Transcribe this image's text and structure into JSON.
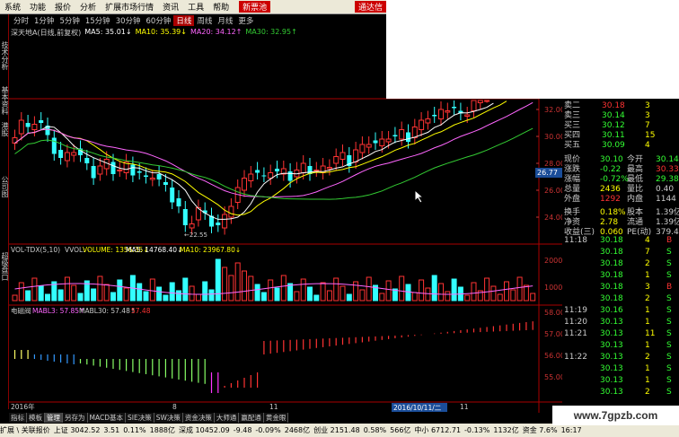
{
  "menu": {
    "items": [
      "系统",
      "功能",
      "报价",
      "分析",
      "扩展市场行情",
      "资讯",
      "工具",
      "帮助"
    ],
    "badge": "新票池",
    "badge2": "通达信"
  },
  "left_tabs": [
    "技术分析",
    "基本资料",
    "港股",
    "公司图",
    "超级盘口"
  ],
  "periods": [
    "分时",
    "1分钟",
    "5分钟",
    "15分钟",
    "30分钟",
    "60分钟",
    "日线",
    "周线",
    "月线",
    "更多"
  ],
  "active_period": "日线",
  "ma_legend": [
    {
      "text": "深天地A(日线,前复权)",
      "color": "#cccccc"
    },
    {
      "text": "MA5: 35.01↓",
      "color": "#ffffff"
    },
    {
      "text": "MA10: 35.39↓",
      "color": "#ffff00"
    },
    {
      "text": "MA20: 34.12↑",
      "color": "#ff66ff"
    },
    {
      "text": "MA30: 32.95↑",
      "color": "#33cc33"
    }
  ],
  "price_axis": [
    "32.00",
    "30.00",
    "28.00",
    "26.00",
    "24.00"
  ],
  "price_tag": "26.77",
  "low_label": "22.55",
  "vol_legend": {
    "title": "VOL-TDX(5,10)",
    "vvol": "VVOL: -",
    "vol": "VOLUME: 1356.35↓",
    "ma5": "MA5: 14768.40↓",
    "ma10": "MA10: 23967.80↓"
  },
  "vol_axis": [
    "20000",
    "10000"
  ],
  "ind_legend": {
    "title": "电磁阀",
    "mabl3": "MABL3: 57.85↑",
    "mabl30": "MABL30: 57.48↑",
    "val": "57.48"
  },
  "ind_axis": [
    "58.00",
    "57.00",
    "56.00",
    "55.00"
  ],
  "date_axis": {
    "start": "2016年",
    "mid": "8",
    "mid2": "11",
    "date_box": "2016/10/11/二",
    "end": "11"
  },
  "bottom_tabs": [
    "指标",
    "模板",
    "管理",
    "另存为",
    "MACD基本",
    "SIE决策",
    "SW决策",
    "资金决策",
    "大师通",
    "赢配通",
    "黄金眼"
  ],
  "status": [
    "上证 3042.52",
    "3.51",
    "0.11%",
    "1888亿",
    "深成 10452.09",
    "-9.48",
    "-0.09%",
    "2468亿",
    "创业 2151.48",
    "0.58%",
    "566亿",
    "中小 6712.71",
    "-0.13%",
    "1132亿",
    "资金 7.6%",
    "16:17"
  ],
  "status2": "扩展 \\ 关联报价",
  "order_book": [
    {
      "label": "卖二",
      "price": "30.18",
      "vol": "3"
    },
    {
      "label": "卖三",
      "price": "30.14",
      "vol": "3"
    },
    {
      "label": "买三",
      "price": "30.12",
      "vol": "7"
    },
    {
      "label": "买四",
      "price": "30.11",
      "vol": "15"
    },
    {
      "label": "买五",
      "price": "30.09",
      "vol": "4"
    }
  ],
  "quote": [
    {
      "l1": "现价",
      "v1": "30.10",
      "l2": "今开",
      "v2": "30.14"
    },
    {
      "l1": "涨跌",
      "v1": "-0.22",
      "l2": "最高",
      "v2": "30.33"
    },
    {
      "l1": "涨幅",
      "v1": "-0.72%",
      "l2": "最低",
      "v2": "29.38"
    },
    {
      "l1": "总量",
      "v1": "2436",
      "l2": "量比",
      "v2": "0.40"
    },
    {
      "l1": "外盘",
      "v1": "1292",
      "l2": "内盘",
      "v2": "1144"
    },
    {
      "l1": "换手",
      "v1": "0.18%",
      "l2": "股本",
      "v2": "1.39亿"
    },
    {
      "l1": "净资",
      "v1": "2.78",
      "l2": "流通",
      "v2": "1.39亿"
    },
    {
      "l1": "收益(三)",
      "v1": "0.060",
      "l2": "PE(动)",
      "v2": "379.4"
    }
  ],
  "ticks": [
    {
      "t": "11:18",
      "p": "30.18",
      "v": "4",
      "s": "B"
    },
    {
      "t": "",
      "p": "30.18",
      "v": "7",
      "s": "S"
    },
    {
      "t": "",
      "p": "30.18",
      "v": "2",
      "s": "S"
    },
    {
      "t": "",
      "p": "30.18",
      "v": "1",
      "s": "S"
    },
    {
      "t": "",
      "p": "30.18",
      "v": "3",
      "s": "B"
    },
    {
      "t": "",
      "p": "30.18",
      "v": "2",
      "s": "S"
    },
    {
      "t": "11:19",
      "p": "30.16",
      "v": "1",
      "s": "S"
    },
    {
      "t": "11:20",
      "p": "30.13",
      "v": "1",
      "s": "S"
    },
    {
      "t": "11:21",
      "p": "30.13",
      "v": "11",
      "s": "S"
    },
    {
      "t": "",
      "p": "30.13",
      "v": "1",
      "s": "S"
    },
    {
      "t": "11:22",
      "p": "30.13",
      "v": "2",
      "s": "S"
    },
    {
      "t": "",
      "p": "30.13",
      "v": "1",
      "s": "S"
    },
    {
      "t": "",
      "p": "30.13",
      "v": "1",
      "s": "S"
    },
    {
      "t": "",
      "p": "30.13",
      "v": "2",
      "s": "S"
    }
  ],
  "watermark": "www.7gpzb.com",
  "colors": {
    "up": "#ff3333",
    "down": "#33ffff",
    "ma5": "#ffffff",
    "ma10": "#ffff00",
    "ma20": "#ff66ff",
    "ma30": "#33cc33",
    "axis": "#aa0000"
  }
}
